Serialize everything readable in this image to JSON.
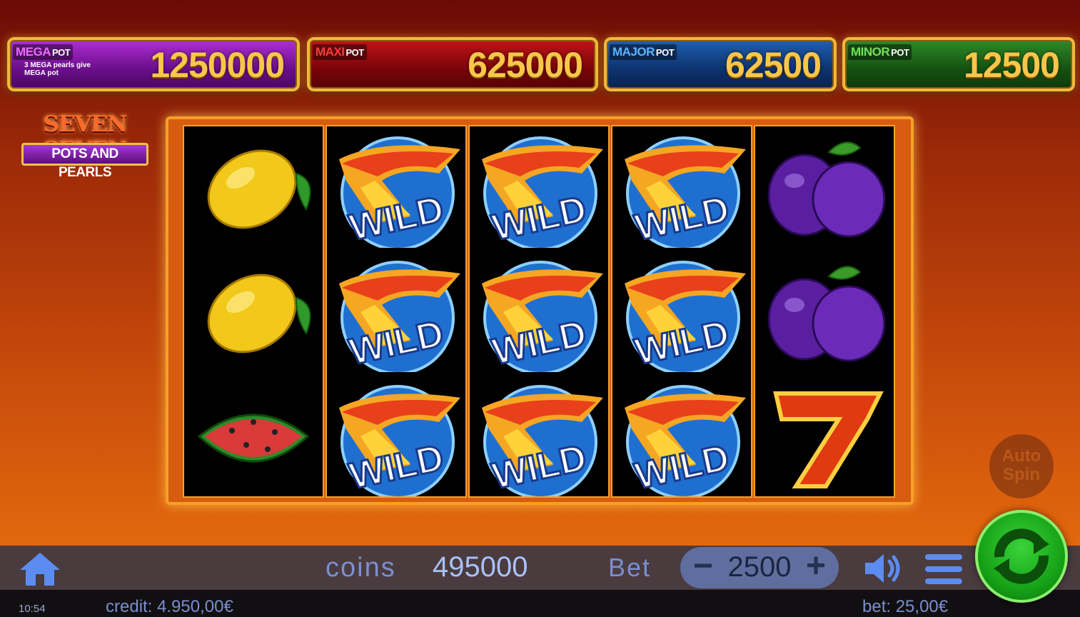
{
  "pots": [
    {
      "name": "MEGA",
      "suffix": "POT",
      "value": "1250000",
      "note": "3 MEGA pearls give MEGA pot"
    },
    {
      "name": "MAXI",
      "suffix": "POT",
      "value": "625000"
    },
    {
      "name": "MAJOR",
      "suffix": "POT",
      "value": "62500"
    },
    {
      "name": "MINOR",
      "suffix": "POT",
      "value": "12500"
    }
  ],
  "logo": {
    "line1": "SEVEN SEVEN",
    "line2": "POTS AND PEARLS"
  },
  "reels": [
    [
      "lemon",
      "lemon",
      "watermelon"
    ],
    [
      "wild",
      "wild",
      "wild"
    ],
    [
      "wild",
      "wild",
      "wild"
    ],
    [
      "wild",
      "wild",
      "wild"
    ],
    [
      "plum",
      "plum",
      "seven"
    ]
  ],
  "wild_text": "WILD",
  "controls": {
    "coins_label": "coins",
    "coins_value": "495000",
    "bet_label": "Bet",
    "bet_value": "2500",
    "minus": "−",
    "plus": "+",
    "autospin_label_1": "Auto",
    "autospin_label_2": "Spin"
  },
  "status": {
    "time": "10:54",
    "credit": "credit: 4.950,00€",
    "bet": "bet: 25,00€"
  },
  "icons": {
    "home": "home-icon",
    "sound": "speaker-icon",
    "menu": "hamburger-menu-icon",
    "spin": "refresh-arrows-icon"
  },
  "colors": {
    "mega": "#b02fd4",
    "maxi": "#c0141a",
    "major": "#1f5fb0",
    "minor": "#2f8a2a",
    "spin": "#17a317"
  }
}
